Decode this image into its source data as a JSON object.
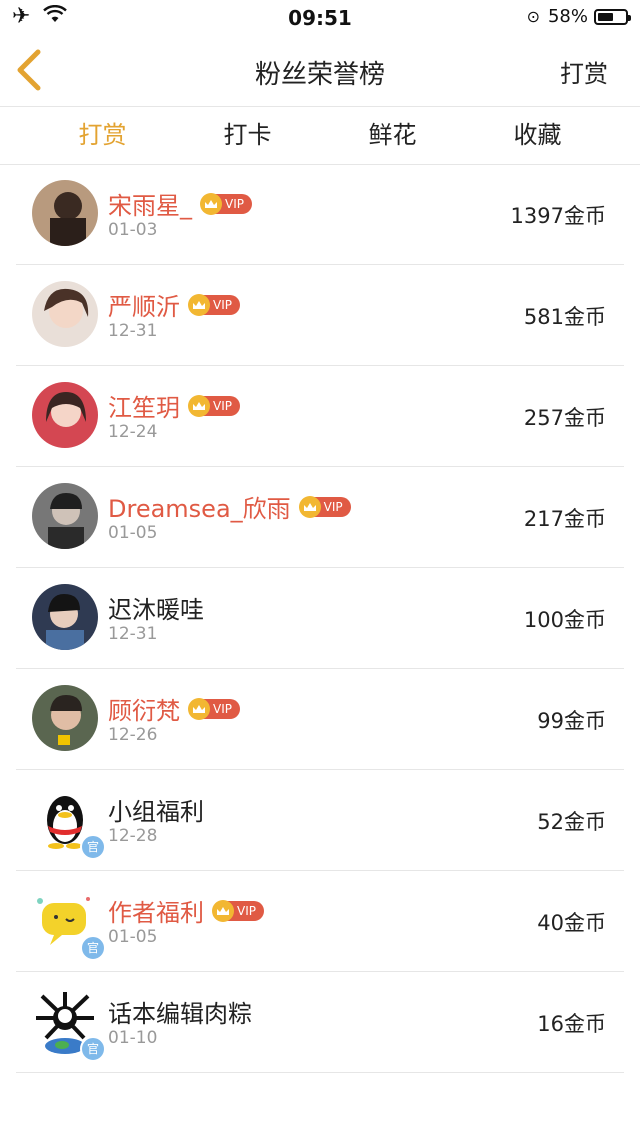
{
  "status": {
    "time": "09:51",
    "battery": "58%",
    "battery_level": 0.58
  },
  "nav": {
    "title": "粉丝荣誉榜",
    "right_label": "打赏"
  },
  "tabs": [
    {
      "label": "打赏",
      "active": true
    },
    {
      "label": "打卡",
      "active": false
    },
    {
      "label": "鲜花",
      "active": false
    },
    {
      "label": "收藏",
      "active": false
    }
  ],
  "vip_label": "VIP",
  "official_label": "官",
  "list": [
    {
      "name": "宋雨星_",
      "date": "01-03",
      "amount": "1397金币",
      "vip": true,
      "official": false
    },
    {
      "name": "严顺沂",
      "date": "12-31",
      "amount": "581金币",
      "vip": true,
      "official": false
    },
    {
      "name": "江笙玥",
      "date": "12-24",
      "amount": "257金币",
      "vip": true,
      "official": false
    },
    {
      "name": "Dreamsea_欣雨",
      "date": "01-05",
      "amount": "217金币",
      "vip": true,
      "official": false
    },
    {
      "name": "迟沐暖哇",
      "date": "12-31",
      "amount": "100金币",
      "vip": false,
      "official": false
    },
    {
      "name": "顾衍梵",
      "date": "12-26",
      "amount": "99金币",
      "vip": true,
      "official": false
    },
    {
      "name": "小组福利",
      "date": "12-28",
      "amount": "52金币",
      "vip": false,
      "official": true
    },
    {
      "name": "作者福利",
      "date": "01-05",
      "amount": "40金币",
      "vip": true,
      "official": true
    },
    {
      "name": "话本编辑肉粽",
      "date": "01-10",
      "amount": "16金币",
      "vip": false,
      "official": true
    }
  ],
  "colors": {
    "accent": "#e3a331",
    "vip_name": "#e05a44",
    "vip_badge": "#e05a44",
    "crown": "#f2b732"
  }
}
